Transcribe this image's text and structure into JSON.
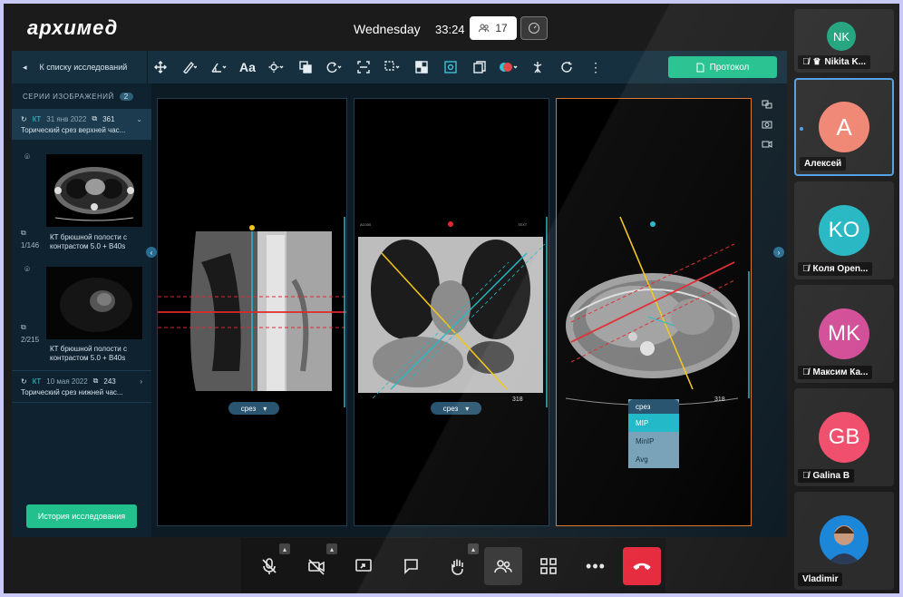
{
  "header": {
    "logo": "архимед",
    "day": "Wednesday",
    "timer": "33:24",
    "participants_count": "17"
  },
  "toolbar": {
    "back_label": "К списку исследований",
    "aa_label": "Aa",
    "protocol_label": "Протокол"
  },
  "sidebar": {
    "title": "СЕРИИ ИЗОБРАЖЕНИЙ",
    "count": "2",
    "series": [
      {
        "type": "КТ",
        "date": "31 янв 2022",
        "count": "361",
        "desc": "Торический срез верхней час..."
      },
      {
        "type": "КТ",
        "date": "10 мая 2022",
        "count": "243",
        "desc": "Торический срез нижней час..."
      }
    ],
    "thumbs": [
      {
        "meta": "1/146",
        "label": "КТ брюшной полости с контрастом 5.0 + B40s"
      },
      {
        "meta": "2/215",
        "label": "КТ брюшной полости с контрастом 5.0 + B40s"
      }
    ],
    "history_label": "История исследования"
  },
  "viewports": {
    "slice_label": "срез",
    "value_318": "318"
  },
  "dropdown": {
    "head": "срез",
    "items": [
      "MIP",
      "MinIP",
      "Avg"
    ]
  },
  "participants": [
    {
      "initials": "NK",
      "name": "Nikita K...",
      "color": "#1fa37c"
    },
    {
      "initials": "A",
      "name": "Алексей",
      "color": "#f08572"
    },
    {
      "initials": "KO",
      "name": "Коля Open...",
      "color": "#26b7c3"
    },
    {
      "initials": "MK",
      "name": "Максим Ка...",
      "color": "#d24f98"
    },
    {
      "initials": "GB",
      "name": "Galina B",
      "color": "#f0506e"
    },
    {
      "initials": "",
      "name": "Vladimir",
      "color": "#1c86d8"
    }
  ],
  "colors": {
    "accent_green": "#21c08c",
    "hangup_red": "#e5273b",
    "selected_border": "#d8742a"
  }
}
